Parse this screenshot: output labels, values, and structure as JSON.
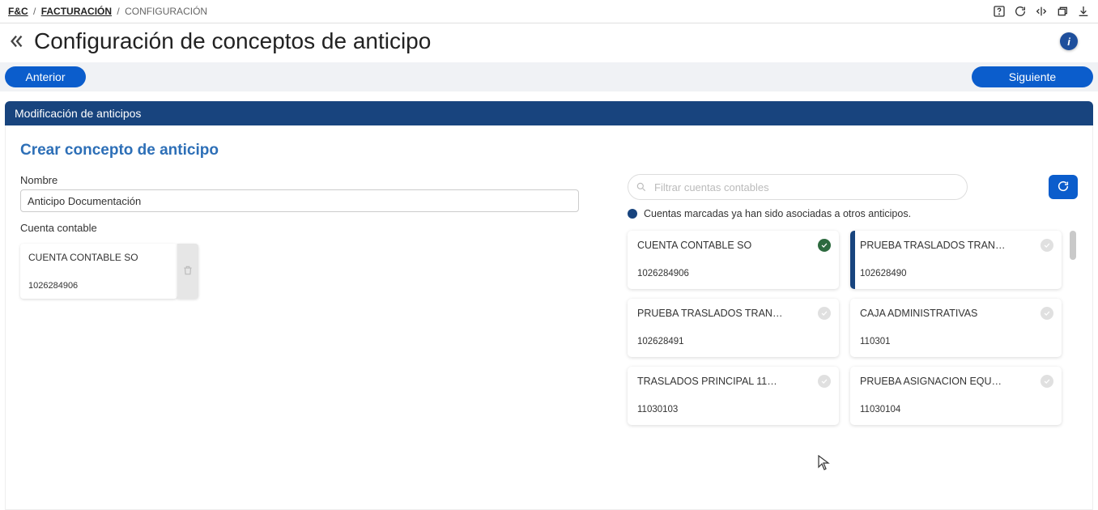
{
  "breadcrumb": {
    "root": "F&C",
    "module": "FACTURACIÓN",
    "current": "CONFIGURACIÓN"
  },
  "page": {
    "title": "Configuración de conceptos de anticipo"
  },
  "nav": {
    "prev": "Anterior",
    "next": "Siguiente"
  },
  "section": {
    "bar_title": "Modificación de anticipos",
    "heading": "Crear concepto de anticipo"
  },
  "form": {
    "name_label": "Nombre",
    "name_value": "Anticipo Documentación",
    "account_label": "Cuenta contable"
  },
  "selected_account": {
    "title": "CUENTA CONTABLE SO",
    "code": "1026284906"
  },
  "filter": {
    "placeholder": "Filtrar cuentas contables"
  },
  "legend": {
    "text": "Cuentas marcadas ya han sido asociadas a otros anticipos."
  },
  "accounts": [
    {
      "title": "CUENTA CONTABLE SO",
      "code": "1026284906",
      "marked": true,
      "bar": false
    },
    {
      "title": "PRUEBA TRASLADOS TRAN…",
      "code": "102628490",
      "marked": false,
      "bar": true
    },
    {
      "title": "PRUEBA TRASLADOS TRAN…",
      "code": "102628491",
      "marked": false,
      "bar": false
    },
    {
      "title": "CAJA ADMINISTRATIVAS",
      "code": "110301",
      "marked": false,
      "bar": false
    },
    {
      "title": "TRASLADOS PRINCIPAL 11…",
      "code": "11030103",
      "marked": false,
      "bar": false
    },
    {
      "title": "PRUEBA ASIGNACION EQU…",
      "code": "11030104",
      "marked": false,
      "bar": false
    }
  ]
}
